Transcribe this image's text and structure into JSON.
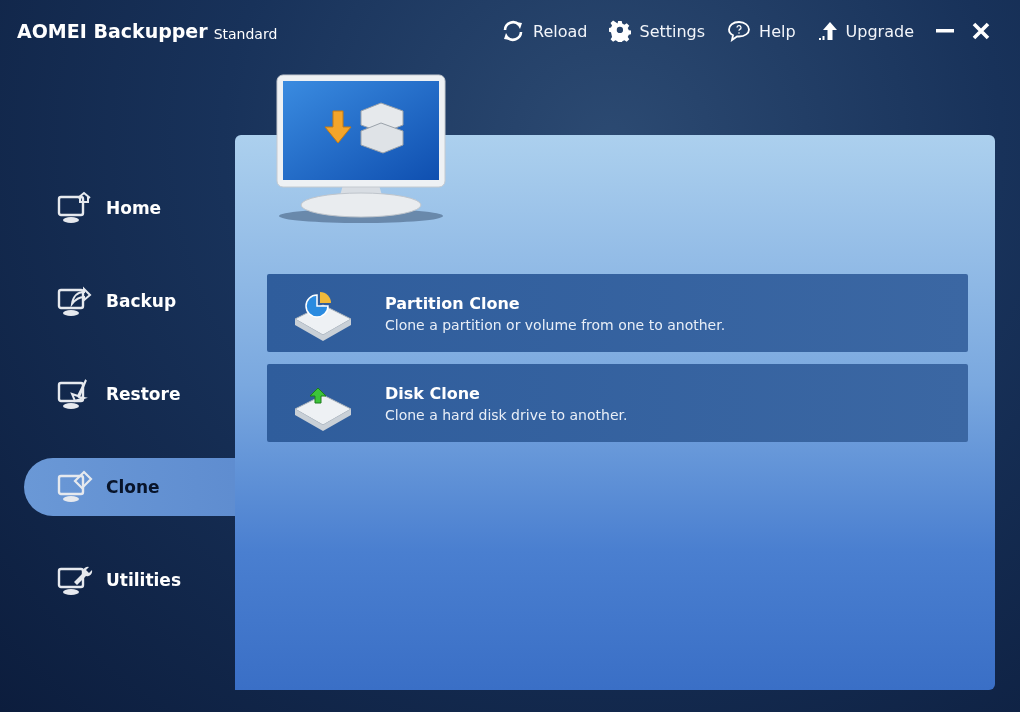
{
  "window": {
    "title": "AOMEI Backupper",
    "edition": "Standard"
  },
  "toolbar": [
    {
      "kind": "reload",
      "label": "Reload"
    },
    {
      "kind": "settings",
      "label": "Settings"
    },
    {
      "kind": "help",
      "label": "Help"
    },
    {
      "kind": "upgrade",
      "label": "Upgrade"
    }
  ],
  "sidebar": {
    "items": [
      {
        "kind": "home",
        "label": "Home",
        "selected": false
      },
      {
        "kind": "backup",
        "label": "Backup",
        "selected": false
      },
      {
        "kind": "restore",
        "label": "Restore",
        "selected": false
      },
      {
        "kind": "clone",
        "label": "Clone",
        "selected": true
      },
      {
        "kind": "utilities",
        "label": "Utilities",
        "selected": false
      }
    ]
  },
  "features": [
    {
      "kind": "partition",
      "title": "Partition Clone",
      "description": "Clone a partition or volume from one to another."
    },
    {
      "kind": "disk",
      "title": "Disk Clone",
      "description": "Clone a hard disk drive to another."
    }
  ]
}
